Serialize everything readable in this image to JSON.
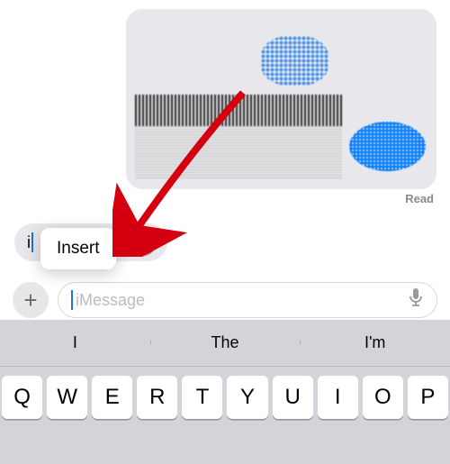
{
  "chat": {
    "read_status": "Read",
    "typing_prefix": "i"
  },
  "popup": {
    "insert_label": "Insert"
  },
  "composer": {
    "placeholder": "iMessage"
  },
  "keyboard": {
    "suggestions": [
      "I",
      "The",
      "I'm"
    ],
    "row1": [
      "Q",
      "W",
      "E",
      "R",
      "T",
      "Y",
      "U",
      "I",
      "O",
      "P"
    ]
  }
}
